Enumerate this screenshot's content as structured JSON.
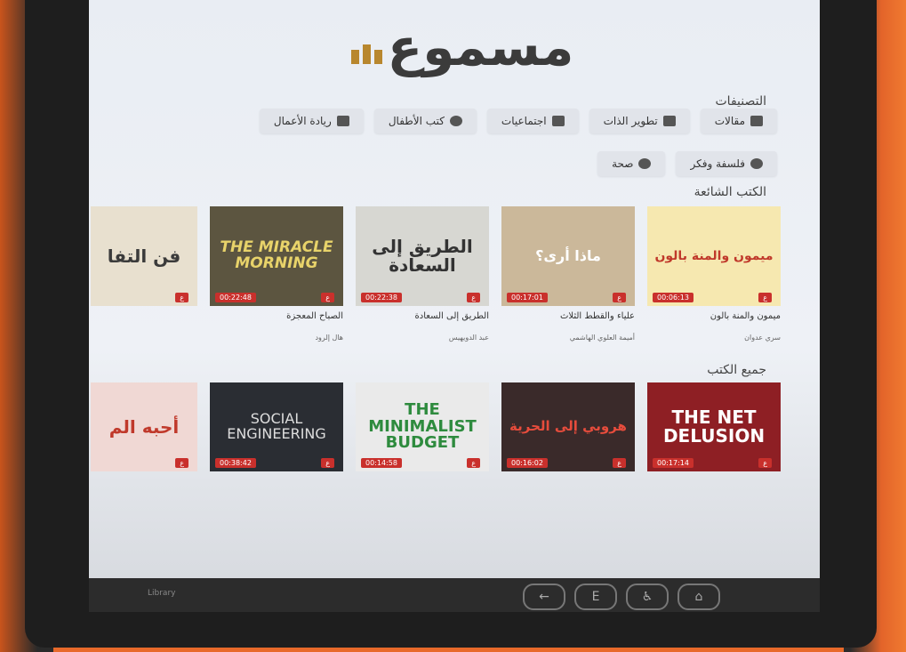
{
  "logo": {
    "text": "مسموع"
  },
  "categories": {
    "title": "التصنيفات",
    "items": [
      {
        "label": "مقالات",
        "icon": "article-icon"
      },
      {
        "label": "تطوير الذات",
        "icon": "trophy-icon"
      },
      {
        "label": "اجتماعيات",
        "icon": "chat-icon"
      },
      {
        "label": "كتب الأطفال",
        "icon": "child-icon"
      },
      {
        "label": "ريادة الأعمال",
        "icon": "people-icon"
      },
      {
        "label": "فلسفة وفكر",
        "icon": "brain-icon"
      },
      {
        "label": "صحة",
        "icon": "health-icon"
      }
    ]
  },
  "popular": {
    "title": "الكتب الشائعة",
    "books": [
      {
        "title": "ميمون والمنة بالون",
        "author": "سري عدوان",
        "duration": "00:06:13",
        "cover_title": "ميمون والمنة بالون",
        "bg": "#f6e8b0",
        "fg": "#c0392b"
      },
      {
        "title": "علياء والقطط الثلاث",
        "author": "أميمة العلوي الهاشمي",
        "duration": "00:17:01",
        "cover_title": "ماذا أرى؟",
        "bg": "#cbb89a",
        "fg": "#ffffff"
      },
      {
        "title": "الطريق إلى السعادة",
        "author": "عبد الدويهيس",
        "duration": "00:22:38",
        "cover_title": "الطريق إلى السعادة",
        "bg": "#d7d7d2",
        "fg": "#333333"
      },
      {
        "title": "الصباح المعجزة",
        "author": "هال إلرود",
        "duration": "00:22:48",
        "cover_title": "THE MIRACLE MORNING",
        "bg": "#5c5540",
        "fg": "#e8d36a"
      },
      {
        "title": "فن التفاؤل",
        "author": "",
        "duration": "",
        "cover_title": "فن التفا",
        "bg": "#e8e0cf",
        "fg": "#3b3b3b"
      }
    ]
  },
  "all_books": {
    "title": "جميع الكتب",
    "books": [
      {
        "duration": "00:17:14",
        "cover_title": "THE NET DELUSION",
        "bg": "#8e1f24",
        "fg": "#ffffff"
      },
      {
        "duration": "00:16:02",
        "cover_title": "هروبي إلى الحرية",
        "bg": "#3a2a2a",
        "fg": "#e74c3c"
      },
      {
        "duration": "00:14:58",
        "cover_title": "THE MINIMALIST BUDGET",
        "bg": "#eaeaea",
        "fg": "#2e8b3e"
      },
      {
        "duration": "00:38:42",
        "cover_title": "SOCIAL ENGINEERING",
        "bg": "#2a2d33",
        "fg": "#dddddd"
      },
      {
        "duration": "",
        "cover_title": "أحبه الم",
        "bg": "#f0d8d4",
        "fg": "#c0392b"
      }
    ]
  },
  "nav": {
    "back": "←",
    "lang": "E",
    "accessibility": "♿",
    "home": "⌂",
    "brand": "Library"
  }
}
